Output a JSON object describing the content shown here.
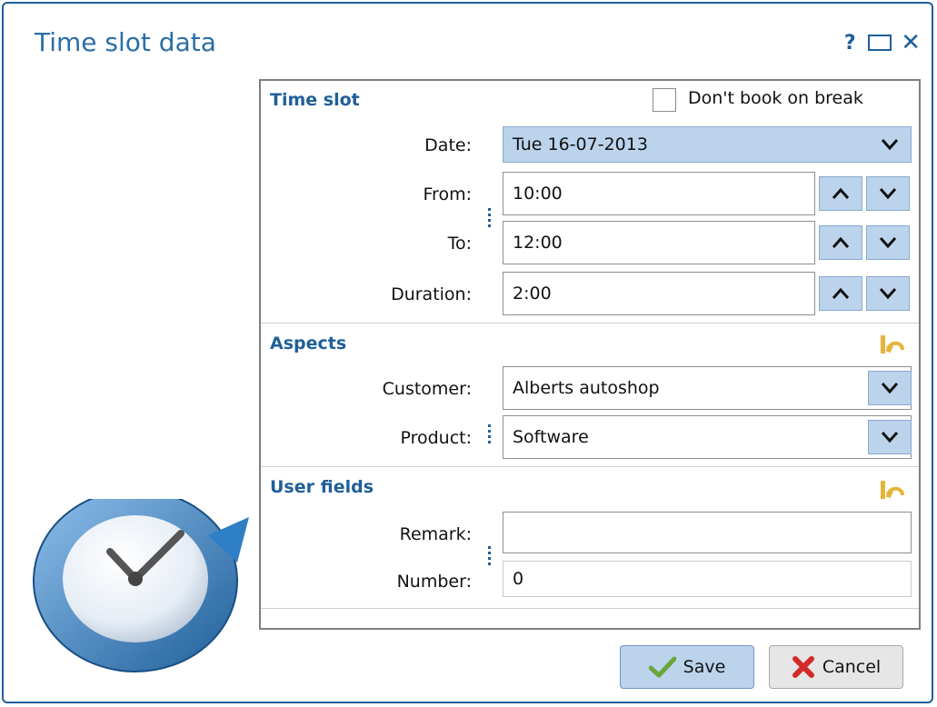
{
  "window": {
    "title": "Time slot data",
    "help_label": "?",
    "close_label": "✕"
  },
  "sections": {
    "time_slot": {
      "title": "Time slot",
      "dont_book_label": "Don't book on break",
      "dont_book_checked": false,
      "date_label": "Date:",
      "date_value": "Tue 16-07-2013",
      "from_label": "From:",
      "from_value": "10:00",
      "to_label": "To:",
      "to_value": "12:00",
      "duration_label": "Duration:",
      "duration_value": "2:00"
    },
    "aspects": {
      "title": "Aspects",
      "customer_label": "Customer:",
      "customer_value": "Alberts autoshop",
      "product_label": "Product:",
      "product_value": "Software"
    },
    "user_fields": {
      "title": "User fields",
      "remark_label": "Remark:",
      "remark_value": "",
      "number_label": "Number:",
      "number_value": "0"
    }
  },
  "buttons": {
    "save_label": "Save",
    "cancel_label": "Cancel"
  },
  "colors": {
    "accent": "#1f5f9a",
    "field_blue": "#bcd3ec",
    "undo_icon": "#e6b43a"
  },
  "icons": [
    "help-icon",
    "maximize-icon",
    "close-icon",
    "chevron-down-icon",
    "chevron-up-icon",
    "undo-icon",
    "checkmark-icon",
    "cancel-x-icon",
    "clock-icon"
  ]
}
